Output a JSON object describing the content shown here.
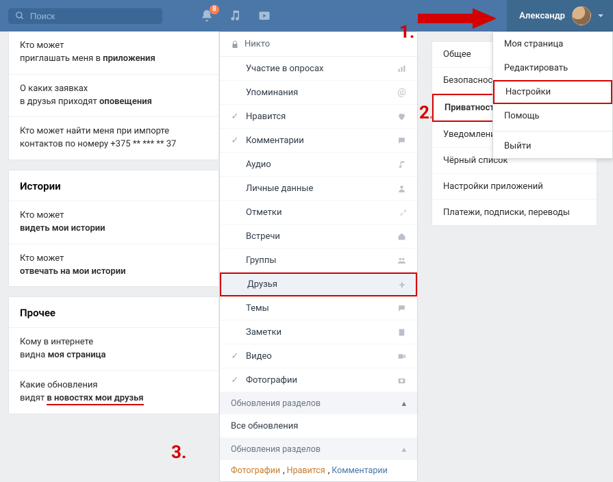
{
  "topbar": {
    "search_placeholder": "Поиск",
    "notif_badge": "8",
    "username": "Александр"
  },
  "annotations": {
    "n1": "1.",
    "n2": "2.",
    "n3": "3."
  },
  "profile_menu": {
    "items": [
      "Моя страница",
      "Редактировать",
      "Настройки",
      "Помощь",
      "Выйти"
    ]
  },
  "left": {
    "rows1": [
      {
        "pre": "Кто может",
        "bold": "приложения",
        "mid": "приглашать меня в "
      },
      {
        "pre": "О каких заявках",
        "bold": "оповещения",
        "mid": "в друзья приходят "
      },
      {
        "pre": "Кто может найти меня при импорте",
        "bold": "",
        "mid": "контактов по номеру +375 ** *** ** 37"
      }
    ],
    "section_stories": "Истории",
    "rows2": [
      {
        "pre": "Кто может",
        "bold": "видеть мои истории"
      },
      {
        "pre": "Кто может",
        "bold": "отвечать на мои истории"
      }
    ],
    "section_other": "Прочее",
    "rows3": [
      {
        "pre": "Кому в интернете",
        "bold": "моя страница",
        "mid": "видна "
      },
      {
        "pre": "Какие обновления",
        "bold": "в новостях мои друзья",
        "mid": "видят "
      }
    ]
  },
  "mid": {
    "lock_label": "Никто",
    "items": [
      {
        "label": "Участие в опросах",
        "icon": "bars"
      },
      {
        "label": "Упоминания",
        "icon": "at"
      },
      {
        "label": "Нравится",
        "icon": "heart",
        "checked": true
      },
      {
        "label": "Комментарии",
        "icon": "comment",
        "checked": true
      },
      {
        "label": "Аудио",
        "icon": "music"
      },
      {
        "label": "Личные данные",
        "icon": "user"
      },
      {
        "label": "Отметки",
        "icon": "expand"
      },
      {
        "label": "Встречи",
        "icon": "home"
      },
      {
        "label": "Группы",
        "icon": "users"
      },
      {
        "label": "Друзья",
        "icon": "plus",
        "highlight": true
      },
      {
        "label": "Темы",
        "icon": "chat"
      },
      {
        "label": "Заметки",
        "icon": "note"
      },
      {
        "label": "Видео",
        "icon": "video",
        "checked": true
      },
      {
        "label": "Фотографии",
        "icon": "camera",
        "checked": true
      }
    ],
    "sub1": "Обновления разделов",
    "sub_all": "Все обновления",
    "sub2": "Обновления разделов",
    "tags": [
      "Фотографии",
      "Нравится",
      "Комментарии"
    ]
  },
  "right_nav": {
    "items": [
      "Общее",
      "Безопасность",
      "Приватность",
      "Уведомления",
      "Чёрный список",
      "Настройки приложений",
      "Платежи, подписки, переводы"
    ],
    "active_index": 2
  }
}
